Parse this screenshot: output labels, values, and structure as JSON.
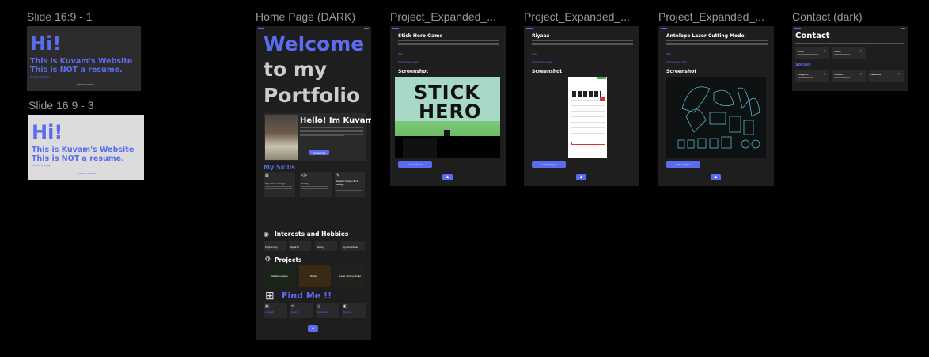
{
  "frames": {
    "slide1": {
      "title": "Slide 16:9 - 1",
      "hi": "Hi!",
      "line1": "This is Kuvam's Website",
      "line2": "This is NOT a resume.",
      "small": "It is kind of though.",
      "cta": "Click to Continue"
    },
    "slide3": {
      "title": "Slide 16:9 - 3",
      "hi": "Hi!",
      "line1": "This is Kuvam's Website",
      "line2": "This is NOT a resume.",
      "small": "It is kind of though.",
      "cta": "Click to Continue"
    },
    "home": {
      "title": "Home Page (DARK)",
      "welcome": "Welcome",
      "to_my": "to my",
      "portfolio": "Portfolio",
      "hello": "Hello! Im Kuvam",
      "about_btn": "Contact Me",
      "skills_heading": "My Skills",
      "skills": [
        {
          "icon": "layout-icon",
          "title": "Experience Design"
        },
        {
          "icon": "code-icon",
          "title": "Coding"
        },
        {
          "icon": "design-icon",
          "title": "Graphic Design & UI Design"
        }
      ],
      "interests_heading": "Interests and Hobbies",
      "interests": [
        "Programming",
        "Digital Art",
        "Singing",
        "Gym and Fitness"
      ],
      "projects_heading": "Projects",
      "projects": [
        "Stickhero game",
        "Riyaaz",
        "Laser Cutting Model"
      ],
      "findme_heading": "Find Me !!",
      "findme": [
        "LinkedIn",
        "Email",
        "Instagram",
        "Discord"
      ]
    },
    "p1": {
      "title": "Project_Expanded_...",
      "name": "Stick Hero Game",
      "role": "Role",
      "tech": "Technologies Used",
      "screenshot": "Screenshot",
      "game_title_1": "STICK",
      "game_title_2": "HERO",
      "link": "Link to Project"
    },
    "p2": {
      "title": "Project_Expanded_...",
      "name": "Riyaaz",
      "role": "Role",
      "tech": "Technologies Used",
      "screenshot": "Screenshot",
      "link": "Link to Project"
    },
    "p3": {
      "title": "Project_Expanded_...",
      "name": "Antelope Lazer Cutting Model",
      "role": "Role",
      "tech": "Technologies Used",
      "screenshot": "Screenshot",
      "link": "Link to Project"
    },
    "contact": {
      "title": "Contact (dark)",
      "heading": "Contact",
      "email": "Email",
      "phone": "Phone",
      "socials": "Socials",
      "socials_list": [
        "Instagram",
        "LinkedIn",
        "Facebook"
      ]
    }
  },
  "colors": {
    "accent": "#5b6cf0",
    "canvas": "#000000",
    "frame_dark": "#1e1e1e"
  }
}
